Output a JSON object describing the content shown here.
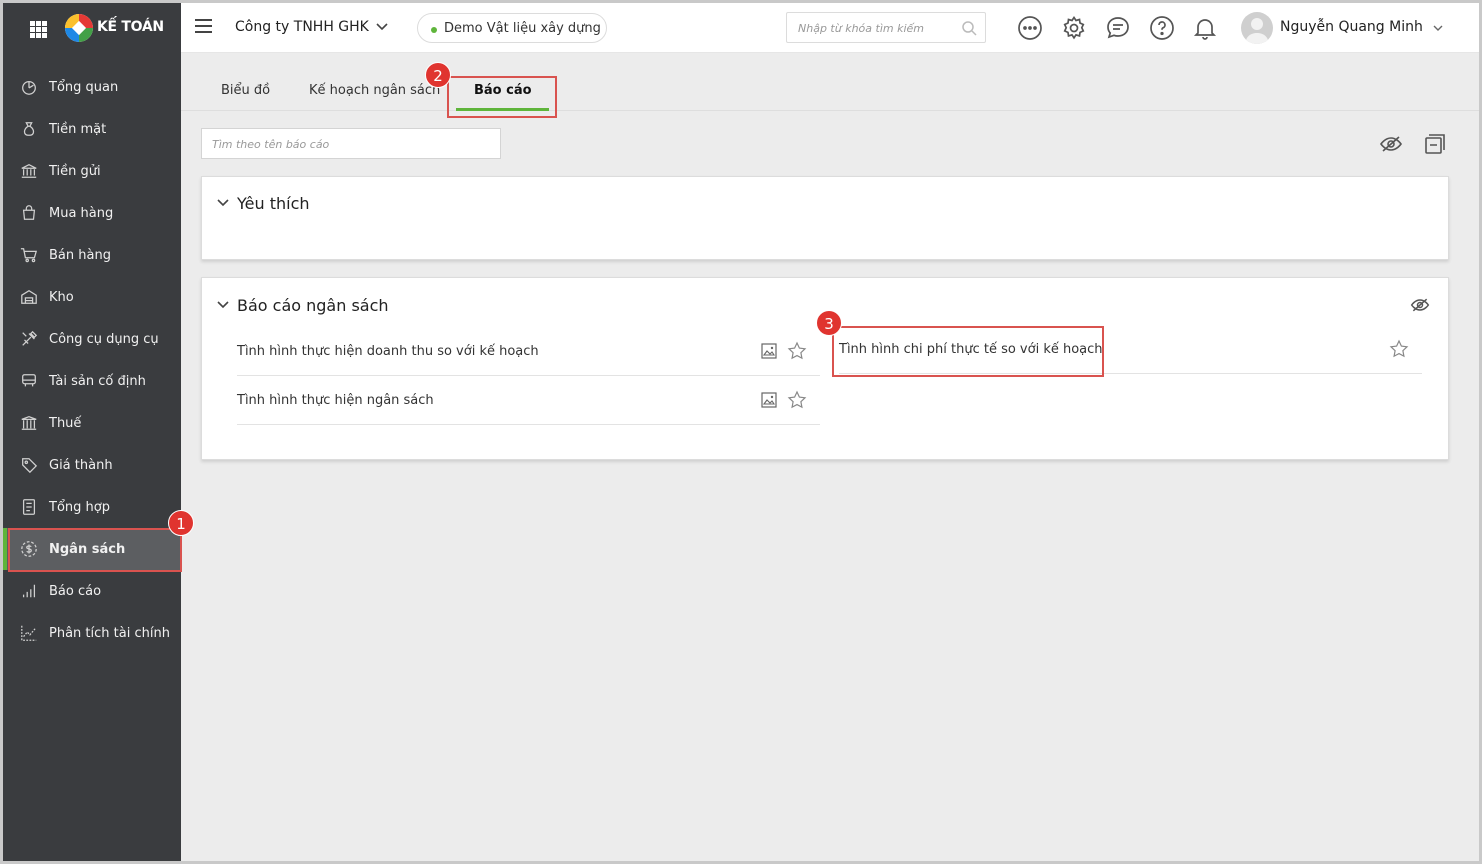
{
  "app": {
    "brand": "KẾ TOÁN"
  },
  "sidebar": {
    "items": [
      {
        "label": "Tổng quan",
        "icon": "dashboard-icon"
      },
      {
        "label": "Tiền mặt",
        "icon": "money-bag-icon"
      },
      {
        "label": "Tiền gửi",
        "icon": "bank-icon"
      },
      {
        "label": "Mua hàng",
        "icon": "shopping-bag-icon"
      },
      {
        "label": "Bán hàng",
        "icon": "cart-icon"
      },
      {
        "label": "Kho",
        "icon": "warehouse-icon"
      },
      {
        "label": "Công cụ dụng cụ",
        "icon": "tools-icon"
      },
      {
        "label": "Tài sản cố định",
        "icon": "asset-icon"
      },
      {
        "label": "Thuế",
        "icon": "tax-icon"
      },
      {
        "label": "Giá thành",
        "icon": "price-tag-icon"
      },
      {
        "label": "Tổng hợp",
        "icon": "ledger-icon"
      },
      {
        "label": "Ngân sách",
        "icon": "budget-icon",
        "active": true
      },
      {
        "label": "Báo cáo",
        "icon": "bar-chart-icon"
      },
      {
        "label": "Phân tích tài chính",
        "icon": "line-chart-icon"
      }
    ]
  },
  "header": {
    "company": "Công ty TNHH GHK",
    "demo": "Demo Vật liệu xây dựng",
    "search_placeholder": "Nhập từ khóa tìm kiếm",
    "user_name": "Nguyễn Quang Minh"
  },
  "tabs": [
    "Biểu đồ",
    "Kế hoạch ngân sách",
    "Báo cáo"
  ],
  "active_tab": "Báo cáo",
  "report_search_placeholder": "Tìm theo tên báo cáo",
  "favorites": {
    "title": "Yêu thích"
  },
  "budget_reports": {
    "title": "Báo cáo ngân sách",
    "items": [
      "Tình hình thực hiện doanh thu so với kế hoạch",
      "Tình hình thực hiện ngân sách",
      "Tình hình chi phí thực tế so với kế hoạch"
    ]
  },
  "annotations": [
    "1",
    "2",
    "3"
  ],
  "colors": {
    "accent": "#5fb53b",
    "sidebar": "#3a3c3f",
    "highlight": "#d9534f",
    "badge": "#e0342f"
  }
}
